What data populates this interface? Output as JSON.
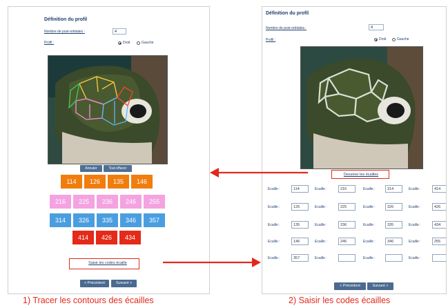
{
  "left_panel": {
    "title": "Définition du profil",
    "postorb_label": "Nombre de post-orbitales :",
    "postorb_value": "4",
    "profil_label": "Profil :",
    "radio_droit": "Droit",
    "radio_gauche": "Gauche",
    "btn_annuler": "Annuler",
    "btn_tout_effacer": "Tout effacer",
    "rows": [
      {
        "color": "#f07d0e",
        "codes": [
          "114",
          "126",
          "135",
          "146"
        ]
      },
      {
        "color": "#f4a3e0",
        "codes": [
          "216",
          "225",
          "236",
          "246",
          "255"
        ]
      },
      {
        "color": "#4a9ee0",
        "codes": [
          "314",
          "326",
          "335",
          "346",
          "357"
        ]
      },
      {
        "color": "#e42a18",
        "codes": [
          "414",
          "426",
          "434"
        ]
      }
    ],
    "link_saisir": "Saisir les codes écaille",
    "btn_precedent": "< Précédent",
    "btn_suivant": "Suivant >"
  },
  "right_panel": {
    "title": "Définition du profil",
    "postorb_label": "Nombre de post-orbitales :",
    "postorb_value": "4",
    "profil_label": "Profil :",
    "radio_droit": "Droit",
    "radio_gauche": "Gauche",
    "link_dessiner": "Dessiner les écailles",
    "ecaille_label": "Ecaille :",
    "grid": [
      [
        "114",
        "216",
        "314",
        "414"
      ],
      [
        "126",
        "225",
        "326",
        "426"
      ],
      [
        "135",
        "236",
        "335",
        "434"
      ],
      [
        "146",
        "246",
        "346",
        "255"
      ],
      [
        "357",
        "",
        "",
        ""
      ]
    ],
    "btn_precedent": "< Précédent",
    "btn_suivant": "Suivant >"
  },
  "captions": {
    "left": "1) Tracer les contours des écailles",
    "right": "2) Saisir les codes écailles"
  },
  "colors": {
    "accent_red": "#e0291c",
    "button_blue": "#4a6a8f",
    "title_navy": "#1f3e6e"
  }
}
